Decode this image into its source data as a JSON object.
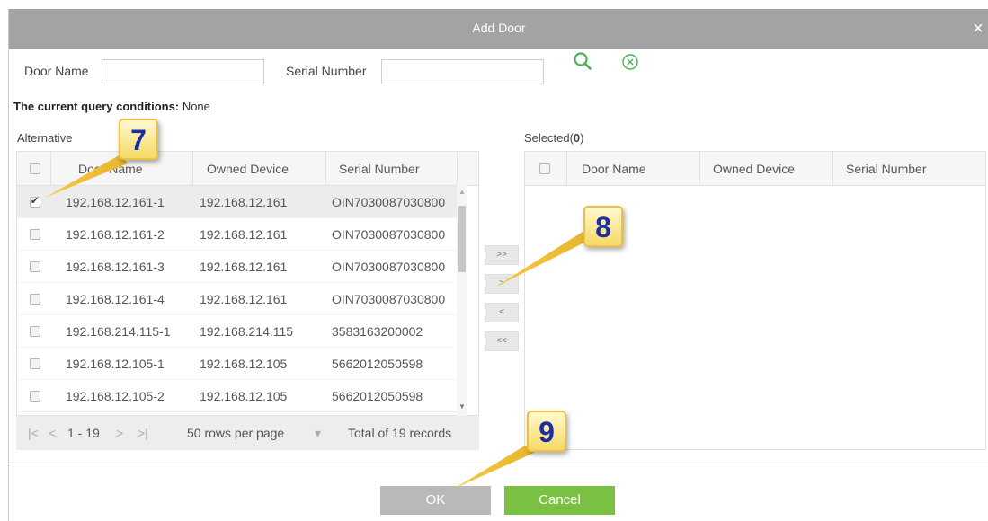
{
  "dialog": {
    "title": "Add Door",
    "close_symbol": "×"
  },
  "filters": {
    "door_name_label": "Door Name",
    "door_name_value": "",
    "serial_number_label": "Serial Number",
    "serial_number_value": "",
    "search_icon": "search-icon",
    "clear_icon": "clear-icon"
  },
  "query": {
    "label": "The current query conditions:",
    "value": "None"
  },
  "alternative": {
    "title": "Alternative",
    "columns": [
      "Door Name",
      "Owned Device",
      "Serial Number"
    ],
    "rows": [
      {
        "door_name": "192.168.12.161-1",
        "owned_device": "192.168.12.161",
        "serial": "OIN7030087030800",
        "checked": true
      },
      {
        "door_name": "192.168.12.161-2",
        "owned_device": "192.168.12.161",
        "serial": "OIN7030087030800",
        "checked": false
      },
      {
        "door_name": "192.168.12.161-3",
        "owned_device": "192.168.12.161",
        "serial": "OIN7030087030800",
        "checked": false
      },
      {
        "door_name": "192.168.12.161-4",
        "owned_device": "192.168.12.161",
        "serial": "OIN7030087030800",
        "checked": false
      },
      {
        "door_name": "192.168.214.115-1",
        "owned_device": "192.168.214.115",
        "serial": "3583163200002",
        "checked": false
      },
      {
        "door_name": "192.168.12.105-1",
        "owned_device": "192.168.12.105",
        "serial": "5662012050598",
        "checked": false
      },
      {
        "door_name": "192.168.12.105-2",
        "owned_device": "192.168.12.105",
        "serial": "5662012050598",
        "checked": false
      }
    ]
  },
  "pager": {
    "first": "|<",
    "prev": "<",
    "range": "1 - 19",
    "next": ">",
    "last": ">|",
    "rows_per_page": "50 rows per page",
    "dropdown_arrow": "▾",
    "total": "Total of 19 records"
  },
  "move_buttons": {
    "all_right": ">>",
    "right": ">",
    "left": "<",
    "all_left": "<<"
  },
  "selected": {
    "title_prefix": "Selected(",
    "count": "0",
    "title_suffix": ")",
    "columns": [
      "Door Name",
      "Owned Device",
      "Serial Number"
    ]
  },
  "buttons": {
    "ok": "OK",
    "cancel": "Cancel"
  },
  "callouts": [
    "7",
    "8",
    "9"
  ],
  "colors": {
    "titlebar": "#a3a3a3",
    "ok_button": "#b9b9b9",
    "cancel_button": "#7ac143",
    "search_icon": "#4caf50",
    "callout_text": "#1b2ea6"
  }
}
